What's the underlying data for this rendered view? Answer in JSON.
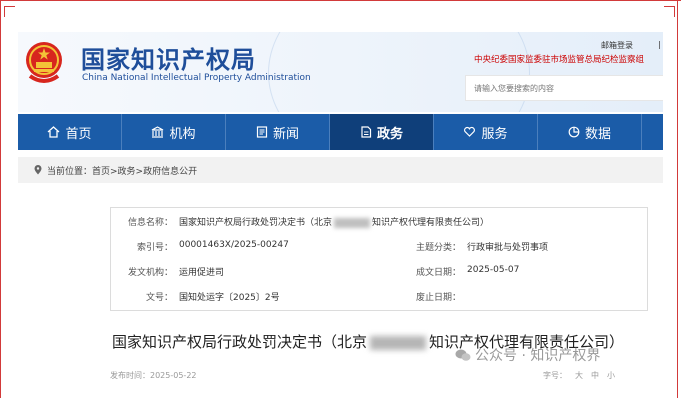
{
  "header": {
    "title_cn": "国家知识产权局",
    "title_en": "China National Intellectual Property Administration",
    "login_label": "邮箱登录",
    "login_sep": "|",
    "discipline_link": "中央纪委国家监委驻市场监管总局纪检监察组",
    "search_placeholder": "请输入您要搜索的内容"
  },
  "nav": {
    "items": [
      {
        "label": "首页",
        "icon": "home-icon"
      },
      {
        "label": "机构",
        "icon": "building-icon"
      },
      {
        "label": "新闻",
        "icon": "news-icon"
      },
      {
        "label": "政务",
        "icon": "document-icon"
      },
      {
        "label": "服务",
        "icon": "heart-hand-icon"
      },
      {
        "label": "数据",
        "icon": "pie-chart-icon"
      }
    ],
    "active_index": 3
  },
  "breadcrumb": {
    "prefix": "当前位置：",
    "path": "首页>政务>政府信息公开"
  },
  "meta": {
    "name_label": "信息名称：",
    "name_value_a": "国家知识产权局行政处罚决定书（北京",
    "name_value_b": "知识产权代理有限责任公司）",
    "index_label": "索引号：",
    "index_value": "00001463X/2025-00247",
    "topic_label": "主题分类：",
    "topic_value": "行政审批与处罚事项",
    "org_label": "发文机构：",
    "org_value": "运用促进司",
    "date_label": "成文日期：",
    "date_value": "2025-05-07",
    "docno_label": "文号：",
    "docno_value": "国知处运字〔2025〕2号",
    "expire_label": "废止日期：",
    "expire_value": ""
  },
  "document": {
    "title_a": "国家知识产权局行政处罚决定书（北京",
    "title_b": "知识产权代理有限责任公司）",
    "pub_label": "发布时间：",
    "pub_date": "2025-05-22",
    "fontsize_label": "字号：",
    "fontsize_options": [
      "大",
      "中",
      "小"
    ]
  },
  "watermark": {
    "text": "公众号 · 知识产权界"
  },
  "colors": {
    "brand_blue": "#1b5ca8",
    "active_nav": "#0f3f7a",
    "title_blue": "#1f4e9a",
    "alert_red": "#cc0000",
    "frame_red": "#d23a3a"
  }
}
